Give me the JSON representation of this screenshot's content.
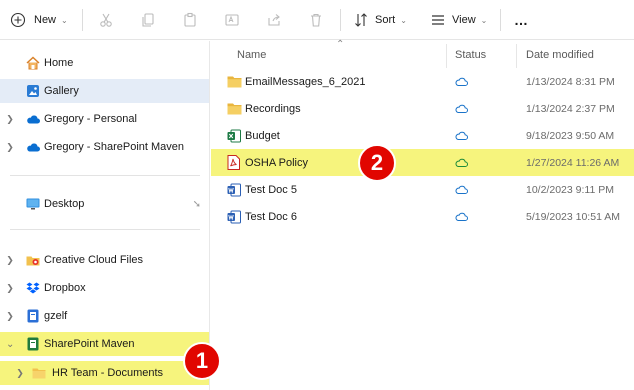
{
  "toolbar": {
    "new_label": "New",
    "sort_label": "Sort",
    "view_label": "View",
    "more_label": "…",
    "icons": [
      "plus-icon",
      "cut-icon",
      "copy-icon",
      "paste-icon",
      "rename-icon",
      "share-icon",
      "delete-icon",
      "sort-icon",
      "view-icon"
    ]
  },
  "sidebar": {
    "items": [
      {
        "label": "Home",
        "icon": "home-icon"
      },
      {
        "label": "Gallery",
        "icon": "gallery-icon"
      },
      {
        "label": "Gregory - Personal",
        "icon": "cloud-icon"
      },
      {
        "label": "Gregory - SharePoint Maven",
        "icon": "cloud-icon"
      },
      {
        "label": "Desktop",
        "icon": "desktop-icon"
      },
      {
        "label": "Creative Cloud Files",
        "icon": "creative-cloud-icon"
      },
      {
        "label": "Dropbox",
        "icon": "dropbox-icon"
      },
      {
        "label": "gzelf",
        "icon": "drive-icon"
      },
      {
        "label": "SharePoint Maven",
        "icon": "sharepoint-icon"
      },
      {
        "label": "HR Team - Documents",
        "icon": "folder-icon"
      }
    ],
    "pin_icon": "pin-icon"
  },
  "list": {
    "headers": {
      "name": "Name",
      "status": "Status",
      "date": "Date modified"
    },
    "rows": [
      {
        "name": "EmailMessages_6_2021",
        "type": "folder",
        "status": "cloud",
        "date": "1/13/2024 8:31 PM"
      },
      {
        "name": "Recordings",
        "type": "folder",
        "status": "cloud",
        "date": "1/13/2024 2:37 PM"
      },
      {
        "name": "Budget",
        "type": "excel",
        "status": "cloud",
        "date": "9/18/2023 9:50 AM"
      },
      {
        "name": "OSHA Policy",
        "type": "pdf",
        "status": "cloud",
        "date": "1/27/2024 11:26 AM"
      },
      {
        "name": "Test Doc 5",
        "type": "word",
        "status": "cloud",
        "date": "10/2/2023 9:11 PM"
      },
      {
        "name": "Test Doc 6",
        "type": "word",
        "status": "cloud",
        "date": "5/19/2023 10:51 AM"
      }
    ]
  },
  "badges": {
    "one": "1",
    "two": "2"
  },
  "colors": {
    "highlight": "#f6f47d",
    "badge": "#e10600",
    "accent": "#0067c0",
    "selection": "#e4ecf7"
  }
}
